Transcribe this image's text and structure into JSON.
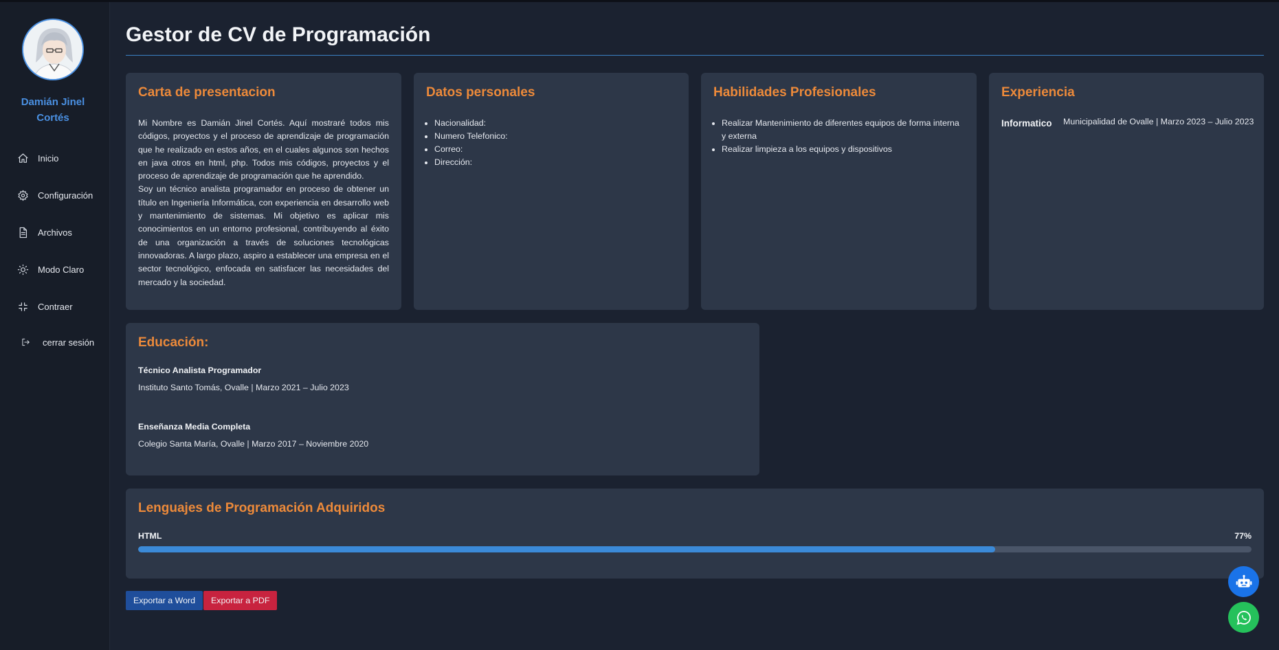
{
  "app": {
    "title": "Gestor de CV de Programación"
  },
  "user": {
    "name_line1": "Damián Jinel",
    "name_line2": "Cortés"
  },
  "sidebar": {
    "items": [
      {
        "label": "Inicio",
        "icon": "home-icon"
      },
      {
        "label": "Configuración",
        "icon": "gear-icon"
      },
      {
        "label": "Archivos",
        "icon": "file-icon"
      },
      {
        "label": "Modo Claro",
        "icon": "sun-icon"
      },
      {
        "label": "Contraer",
        "icon": "collapse-icon"
      },
      {
        "label": "cerrar sesión",
        "icon": "logout-icon"
      }
    ]
  },
  "cards": {
    "carta": {
      "title": "Carta de presentacion",
      "p1": "Mi Nombre es Damián Jinel Cortés. Aquí mostraré todos mis códigos, proyectos y el proceso de aprendizaje de programación que he realizado en estos años, en el cuales algunos son hechos en java otros en html, php. Todos mis códigos, proyectos y el proceso de aprendizaje de programación que he aprendido.",
      "p2": "Soy un técnico analista programador en proceso de obtener un título en Ingeniería Informática, con experiencia en desarrollo web y mantenimiento de sistemas. Mi objetivo es aplicar mis conocimientos en un entorno profesional, contribuyendo al éxito de una organización a través de soluciones tecnológicas innovadoras. A largo plazo, aspiro a establecer una empresa en el sector tecnológico, enfocada en satisfacer las necesidades del mercado y la sociedad."
    },
    "datos": {
      "title": "Datos personales",
      "items": [
        "Nacionalidad:",
        "Numero Telefonico:",
        "Correo:",
        "Dirección:"
      ]
    },
    "habilidades": {
      "title": "Habilidades Profesionales",
      "items": [
        "Realizar Mantenimiento de diferentes equipos de forma interna y externa",
        "Realizar limpieza a los equipos y dispositivos"
      ]
    },
    "experiencia": {
      "title": "Experiencia",
      "role": "Informatico",
      "detail": "Municipalidad de Ovalle | Marzo 2023 – Julio 2023"
    },
    "educacion": {
      "title": "Educación:",
      "entries": [
        {
          "title": "Técnico Analista Programador",
          "detail": "Instituto Santo Tomás, Ovalle | Marzo 2021 – Julio 2023"
        },
        {
          "title": "Enseñanza Media Completa",
          "detail": "Colegio Santa María, Ovalle | Marzo 2017 – Noviembre 2020"
        }
      ]
    },
    "lenguajes": {
      "title": "Lenguajes de Programación Adquiridos",
      "items": [
        {
          "name": "HTML",
          "percent_label": "77%",
          "percent": 77
        }
      ]
    }
  },
  "buttons": {
    "word": "Exportar a Word",
    "pdf": "Exportar a PDF"
  },
  "colors": {
    "accent": "#ed8a3a",
    "link": "#4a90e2",
    "bar": "#3b8ad8",
    "word": "#1f4e9b",
    "pdf": "#c8233f",
    "whatsapp": "#25c15b",
    "bot": "#1a73e8"
  }
}
